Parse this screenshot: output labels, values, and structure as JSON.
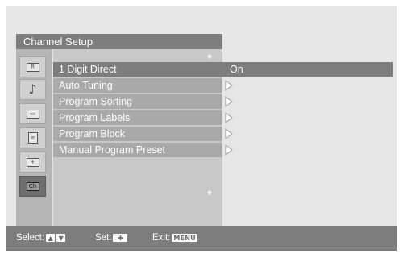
{
  "header": {
    "title": "Channel Setup"
  },
  "sidebar": {
    "icons": [
      {
        "name": "picture-icon",
        "glyph": "R"
      },
      {
        "name": "sound-icon",
        "glyph": "♪"
      },
      {
        "name": "screen-icon",
        "glyph": "▭"
      },
      {
        "name": "features-icon",
        "glyph": "≡"
      },
      {
        "name": "setup-icon",
        "glyph": "+"
      },
      {
        "name": "channel-setup-icon",
        "glyph": "Ch",
        "active": true
      }
    ]
  },
  "menu": {
    "items": [
      {
        "label": "1 Digit Direct",
        "selected": true
      },
      {
        "label": "Auto Tuning"
      },
      {
        "label": "Program Sorting"
      },
      {
        "label": "Program Labels"
      },
      {
        "label": "Program Block"
      },
      {
        "label": "Manual Program Preset"
      }
    ],
    "selected_value": "On"
  },
  "footer": {
    "select_label": "Select:",
    "set_label": "Set:",
    "exit_label": "Exit:",
    "up_key": "▲",
    "down_key": "▼",
    "set_key": "✚",
    "menu_key": "MENU"
  },
  "colors": {
    "background": "#e6e6e6",
    "bar": "#7d7d7d",
    "item": "#a9a9a9",
    "panel": "#c8c8c8",
    "icon_column": "#b5b5b5"
  }
}
